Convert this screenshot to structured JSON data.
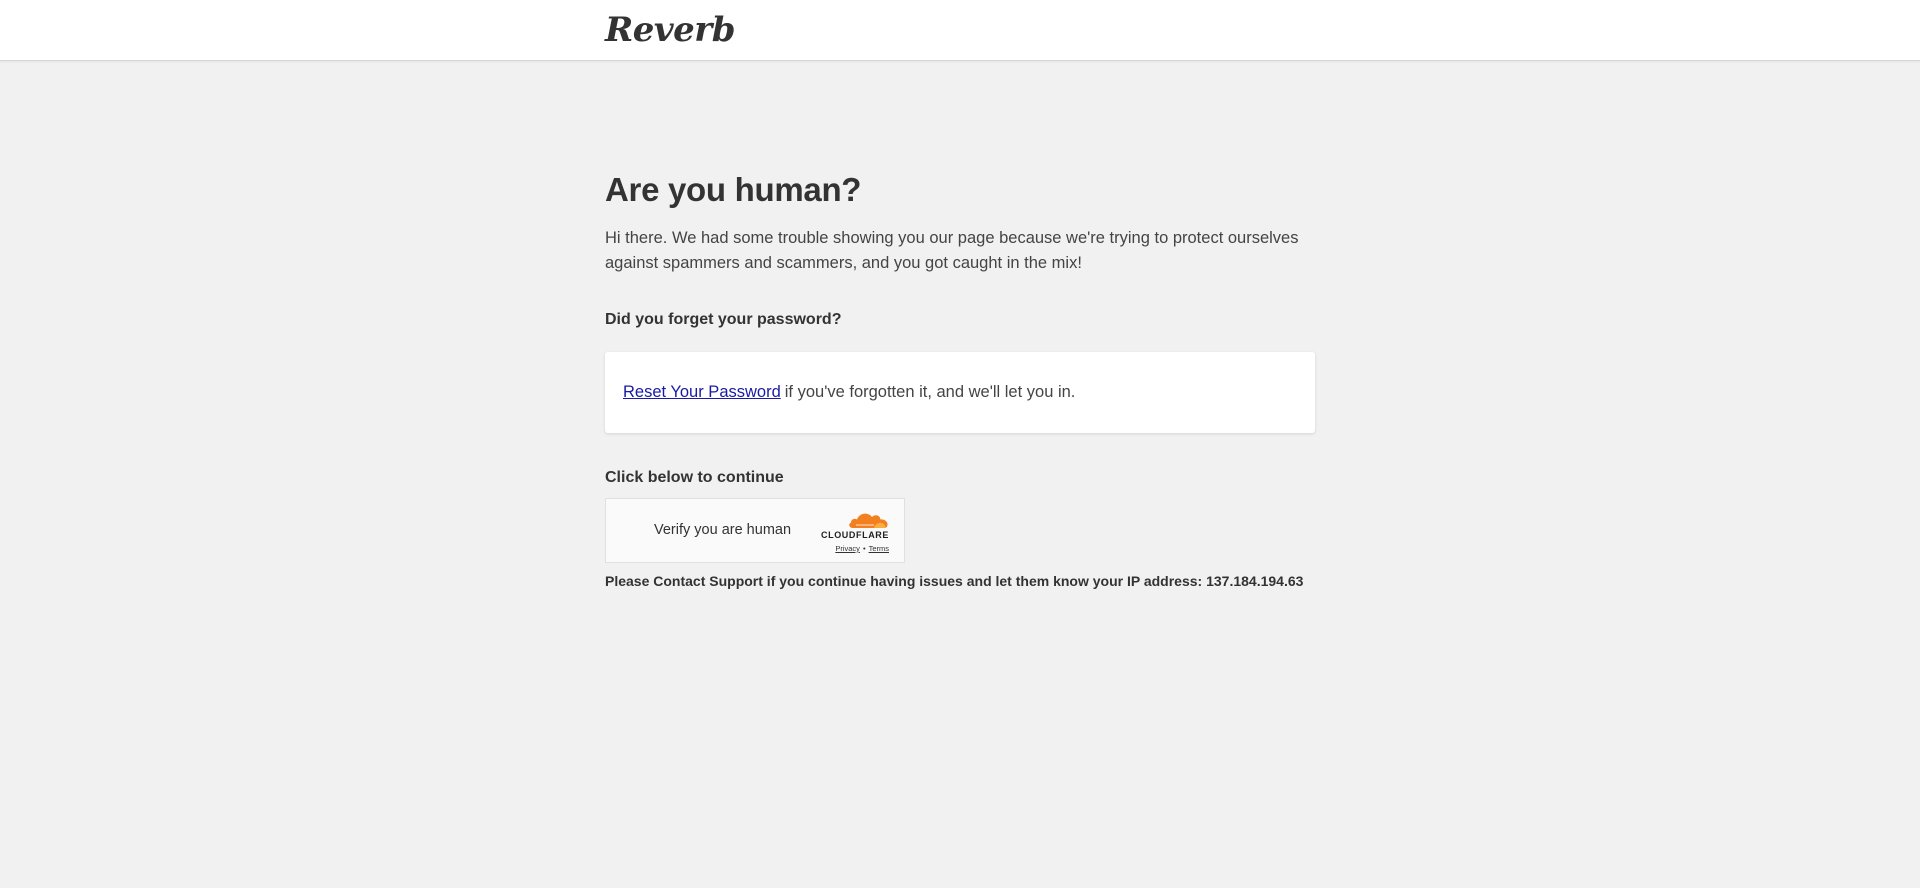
{
  "header": {
    "logo_text": "Reverb"
  },
  "main": {
    "title": "Are you human?",
    "intro": "Hi there. We had some trouble showing you our page because we're trying to protect ourselves against spammers and scammers, and you got caught in the mix!",
    "forgot_title": "Did you forget your password?",
    "reset_link_label": "Reset Your Password",
    "reset_text": "if you've forgotten it, and we'll let you in.",
    "continue_title": "Click below to continue",
    "support_text": "Please Contact Support if you continue having issues and let them know your IP address: 137.184.194.63"
  },
  "widget": {
    "label": "Verify you are human",
    "brand": "CLOUDFLARE",
    "privacy_label": "Privacy",
    "separator": "•",
    "terms_label": "Terms"
  },
  "colors": {
    "background": "#f1f1f1",
    "link": "#1a1aa6",
    "cloudflare_orange": "#f38020"
  },
  "icons": {
    "logo": "reverb-wordmark",
    "cloud": "cloudflare-cloud-icon"
  }
}
